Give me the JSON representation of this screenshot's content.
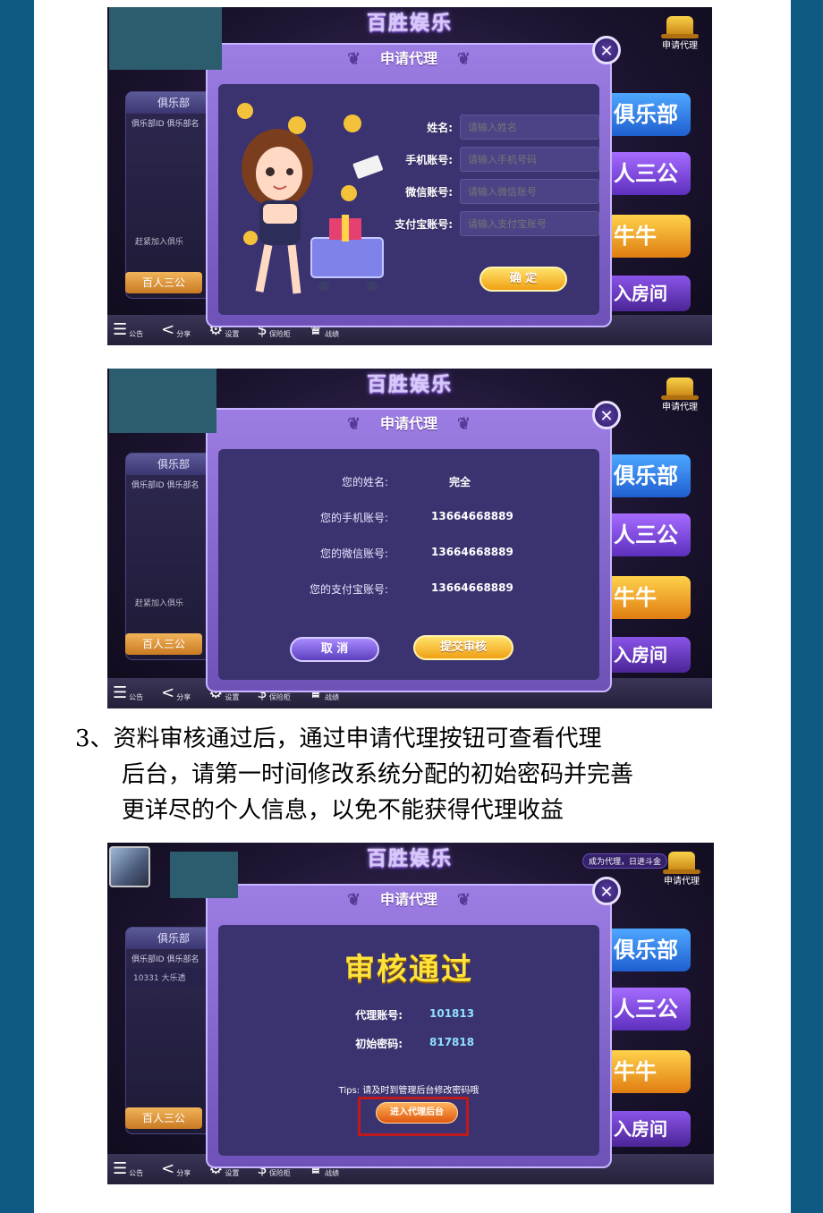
{
  "colors": {
    "outer_bg": "#0f5a82",
    "page_bg": "#ffffff",
    "accent_yellow": "#ffe23a",
    "dialog_purple": "#6e52b8"
  },
  "common": {
    "logo": "百胜娱乐",
    "apply_agent": "申请代理",
    "close": "✕",
    "club_panel_title": "俱乐部",
    "club_cols": "俱乐部ID  俱乐部名",
    "club_empty_text": "赶紧加入俱乐",
    "baijia_sangong": "百人三公",
    "right_buttons": [
      "俱乐部",
      "人三公",
      "牛牛",
      "入房间"
    ],
    "bottom_bar": [
      {
        "icon": "☰",
        "label": "公告"
      },
      {
        "icon": "<",
        "label": "分享"
      },
      {
        "icon": "⚙",
        "label": "设置"
      },
      {
        "icon": "$",
        "label": "保险柜"
      },
      {
        "icon": "♛",
        "label": "战绩"
      }
    ]
  },
  "screen1": {
    "dialog_title": "申请代理",
    "fields": [
      {
        "label": "姓名:",
        "placeholder": "请输入姓名"
      },
      {
        "label": "手机账号:",
        "placeholder": "请输入手机号码"
      },
      {
        "label": "微信账号:",
        "placeholder": "请输入微信账号"
      },
      {
        "label": "支付宝账号:",
        "placeholder": "请输入支付宝账号"
      }
    ],
    "confirm_button": "确 定"
  },
  "screen2": {
    "dialog_title": "申请代理",
    "rows": [
      {
        "label": "您的姓名:",
        "value": "完全"
      },
      {
        "label": "您的手机账号:",
        "value": "13664668889"
      },
      {
        "label": "您的微信账号:",
        "value": "13664668889"
      },
      {
        "label": "您的支付宝账号:",
        "value": "13664668889"
      }
    ],
    "cancel_button": "取 消",
    "submit_button": "提交审核"
  },
  "step_note": {
    "line1": "3、资料审核通过后，通过申请代理按钮可查看代理",
    "line2": "后台，请第一时间修改系统分配的初始密码并完善",
    "line3": "更详尽的个人信息，以免不能获得代理收益"
  },
  "screen3": {
    "promo_badge": "成为代理，日进斗金",
    "club_row": "10331   大乐透",
    "dialog_title": "申请代理",
    "status": "审核通过",
    "account_label": "代理账号:",
    "account_value": "101813",
    "password_label": "初始密码:",
    "password_value": "817818",
    "tips": "Tips: 请及时到管理后台修改密码哦",
    "enter_button": "进入代理后台"
  }
}
